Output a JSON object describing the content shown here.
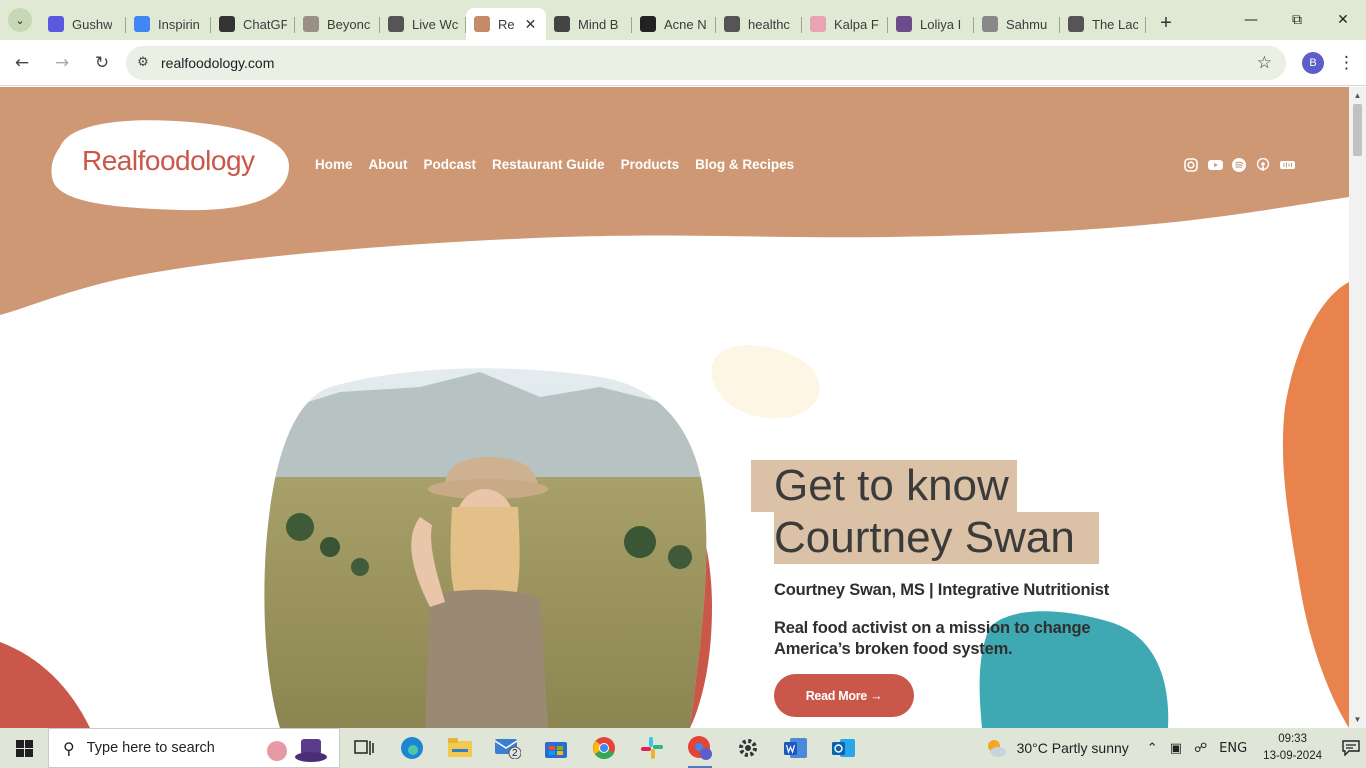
{
  "browser": {
    "tabs": [
      {
        "title": "Gushw",
        "favicon_color": "#5a57e0"
      },
      {
        "title": "Inspirin",
        "favicon_color": "#4285f4"
      },
      {
        "title": "ChatGF",
        "favicon_color": "#333333"
      },
      {
        "title": "Beyonc",
        "favicon_color": "#9a8f86"
      },
      {
        "title": "Live Wc",
        "favicon_color": "#555555"
      },
      {
        "title": "Re",
        "favicon_color": "#c78a68",
        "active": true
      },
      {
        "title": "Mind B",
        "favicon_color": "#444444"
      },
      {
        "title": "Acne N",
        "favicon_color": "#222222"
      },
      {
        "title": "healthc",
        "favicon_color": "#555555"
      },
      {
        "title": "Kalpa F",
        "favicon_color": "#e8a3b4"
      },
      {
        "title": "Loliya I",
        "favicon_color": "#6b4b8a"
      },
      {
        "title": "Sahmu",
        "favicon_color": "#888888"
      },
      {
        "title": "The Lac",
        "favicon_color": "#555555"
      }
    ],
    "address": "realfoodology.com",
    "profile_initial": "B",
    "tab_menu_icon": "chevron-down-icon",
    "active_close_icon": "close-icon"
  },
  "site": {
    "logo": "Realfoodology",
    "nav": [
      "Home",
      "About",
      "Podcast",
      "Restaurant Guide",
      "Products",
      "Blog & Recipes"
    ],
    "social_icons": [
      "instagram-icon",
      "youtube-icon",
      "spotify-icon",
      "podcast-icon",
      "audio-icon"
    ],
    "hero": {
      "title_line1": "Get to know",
      "title_line2": "Courtney Swan",
      "subtitle": "Courtney Swan, MS | Integrative Nutritionist",
      "description": "Real food activist on a mission to change America’s broken food system.",
      "cta": "Read More →"
    },
    "colors": {
      "header": "#cd9873",
      "accent": "#c9584a",
      "orange": "#e8834e",
      "teal": "#3fa9b3",
      "cream": "#fdf6e4",
      "highlight": "#dbc2a7"
    }
  },
  "taskbar": {
    "search_placeholder": "Type here to search",
    "mail_badge": "2",
    "weather": "30°C  Partly sunny",
    "lang": "ENG",
    "time": "09:33",
    "date": "13-09-2024"
  }
}
